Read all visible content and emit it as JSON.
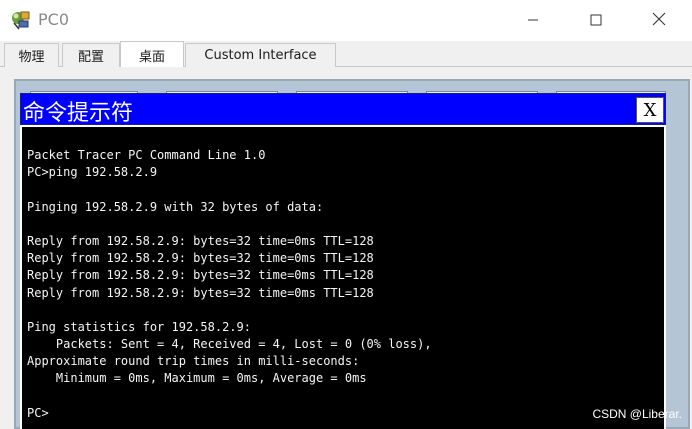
{
  "window": {
    "title": "PC0",
    "icon": "packet-tracer-pc-icon",
    "controls": [
      "minimize-icon",
      "maximize-icon",
      "close-icon"
    ]
  },
  "tabs": [
    {
      "label": "物理",
      "active": false
    },
    {
      "label": "配置",
      "active": false
    },
    {
      "label": "桌面",
      "active": true
    },
    {
      "label": "Custom Interface",
      "active": false
    }
  ],
  "command_prompt": {
    "title": "命令提示符",
    "close_label": "X",
    "lines": [
      "Packet Tracer PC Command Line 1.0",
      "PC>ping 192.58.2.9",
      "",
      "Pinging 192.58.2.9 with 32 bytes of data:",
      "",
      "Reply from 192.58.2.9: bytes=32 time=0ms TTL=128",
      "Reply from 192.58.2.9: bytes=32 time=0ms TTL=128",
      "Reply from 192.58.2.9: bytes=32 time=0ms TTL=128",
      "Reply from 192.58.2.9: bytes=32 time=0ms TTL=128",
      "",
      "Ping statistics for 192.58.2.9:",
      "    Packets: Sent = 4, Received = 4, Lost = 0 (0% loss),",
      "Approximate round trip times in milli-seconds:",
      "    Minimum = 0ms, Maximum = 0ms, Average = 0ms",
      "",
      "PC>"
    ]
  },
  "watermark": "CSDN @Liberar.",
  "colors": {
    "cmd_titlebar": "#0000ff",
    "terminal_bg": "#000000",
    "terminal_text": "#f5f5f5"
  }
}
